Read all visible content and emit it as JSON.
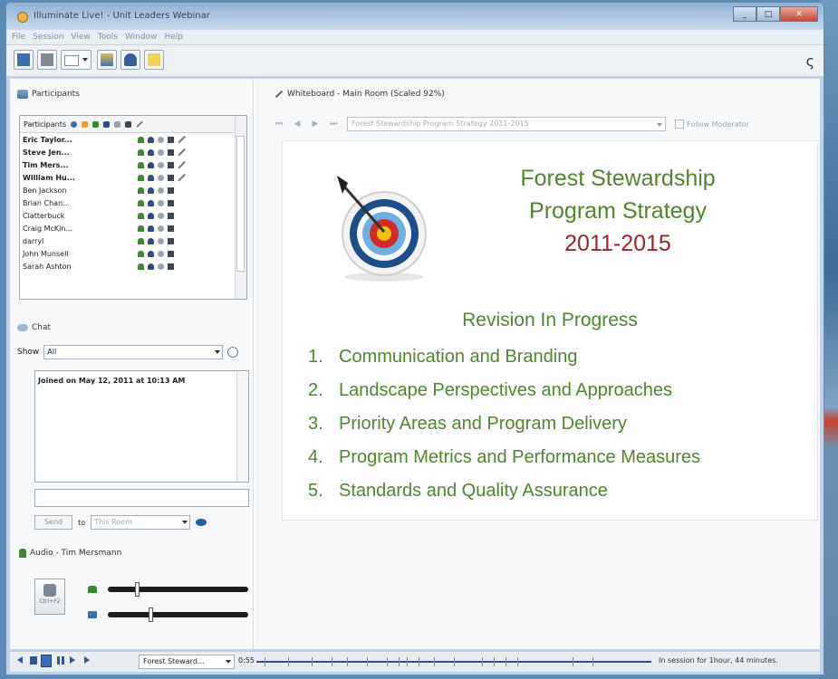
{
  "window": {
    "title": "Illuminate Live! - Unit Leaders Webinar"
  },
  "menu": [
    "File",
    "Session",
    "View",
    "Tools",
    "Window",
    "Help"
  ],
  "participants": {
    "title": "Participants",
    "column_label": "Participants",
    "rows": [
      {
        "name": "Eric Taylor...",
        "bold": true
      },
      {
        "name": "Steve Jen...",
        "bold": true
      },
      {
        "name": "Tim Mers...",
        "bold": true
      },
      {
        "name": "William Hu...",
        "bold": true
      },
      {
        "name": "Ben Jackson",
        "bold": false
      },
      {
        "name": "Brian Chan...",
        "bold": false
      },
      {
        "name": "Clatterbuck",
        "bold": false
      },
      {
        "name": "Craig McKin...",
        "bold": false
      },
      {
        "name": "darryl",
        "bold": false
      },
      {
        "name": "John Munsell",
        "bold": false
      },
      {
        "name": "Sarah Ashton",
        "bold": false
      }
    ]
  },
  "chat": {
    "title": "Chat",
    "show_label": "Show",
    "show_value": "All",
    "message": "Joined on May 12, 2011 at 10:13 AM",
    "send_label": "Send",
    "to_label": "to",
    "to_value": "This Room"
  },
  "audio": {
    "title": "Audio - Tim Mersmann",
    "talk_label": "Ctrl+F2",
    "mic_level": 0.2,
    "speaker_level": 0.3
  },
  "whiteboard": {
    "title": "Whiteboard - Main Room (Scaled 92%)",
    "slide_select": "Forest Stewardship Program Strategy 2011-2015",
    "follow_label": "Follow Moderator"
  },
  "slide": {
    "title_line1": "Forest Stewardship",
    "title_line2": "Program Strategy",
    "years": "2011-2015",
    "subtitle": "Revision In Progress",
    "items": [
      {
        "num": "1.",
        "text": "Communication and Branding"
      },
      {
        "num": "2.",
        "text": "Landscape Perspectives and Approaches"
      },
      {
        "num": "3.",
        "text": "Priority Areas and Program Delivery"
      },
      {
        "num": "4.",
        "text": "Program Metrics and Performance Measures"
      },
      {
        "num": "5.",
        "text": "Standards and Quality Assurance"
      }
    ]
  },
  "playback": {
    "slide_select": "Forest Steward...",
    "time": "0:55",
    "session_text": "In session for 1hour, 44 minutes."
  },
  "colors": {
    "slide_green": "#4f8630",
    "slide_red": "#a0242b"
  }
}
